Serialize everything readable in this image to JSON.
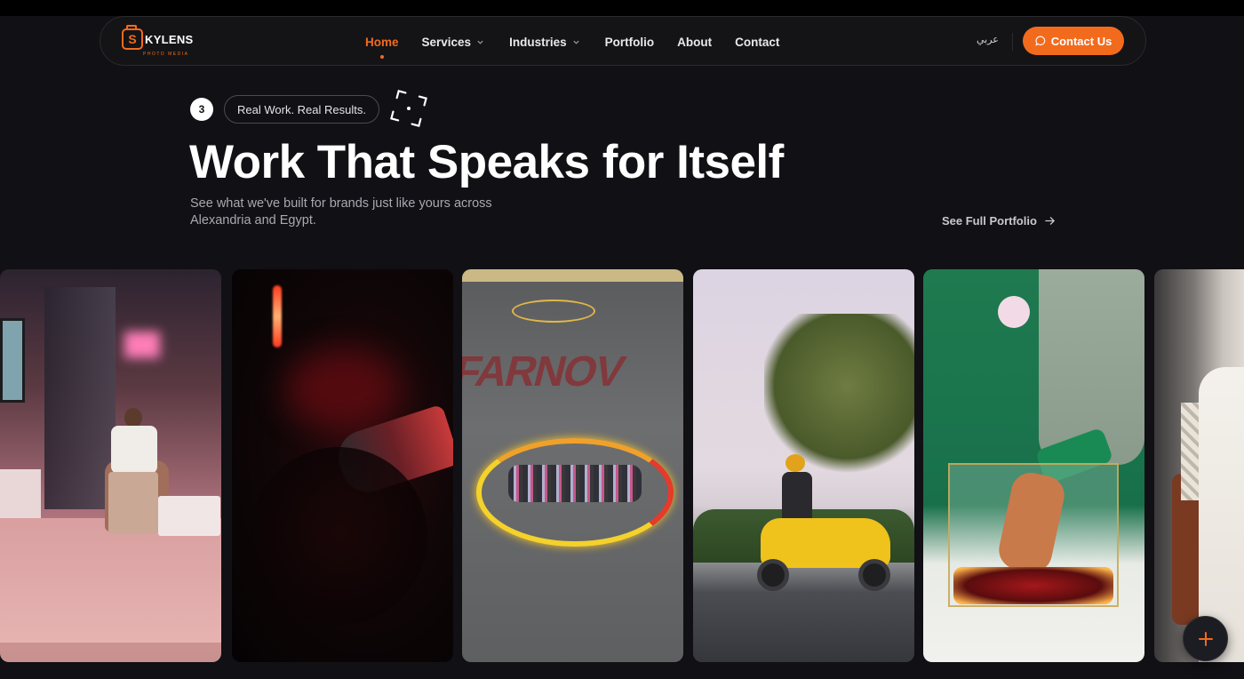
{
  "brand": {
    "name": "KYLENS",
    "logo_letter": "S",
    "logo_tagline": "PHOTO MEDIA",
    "accent": "#f26b1d"
  },
  "nav": {
    "items": [
      {
        "label": "Home",
        "active": true,
        "has_dropdown": false
      },
      {
        "label": "Services",
        "active": false,
        "has_dropdown": true
      },
      {
        "label": "Industries",
        "active": false,
        "has_dropdown": true
      },
      {
        "label": "Portfolio",
        "active": false,
        "has_dropdown": false
      },
      {
        "label": "About",
        "active": false,
        "has_dropdown": false
      },
      {
        "label": "Contact",
        "active": false,
        "has_dropdown": false
      }
    ],
    "language_toggle": "عربي",
    "contact_button": "Contact Us"
  },
  "hero": {
    "step_number": "3",
    "tagline": "Real Work. Real Results.",
    "title": "Work That Speaks for Itself",
    "description": "See what we've built for brands just like yours across Alexandria and Egypt.",
    "see_full_link": "See Full Portfolio"
  },
  "portfolio": {
    "cards": [
      {
        "subject": "living-room-shoot"
      },
      {
        "subject": "red-motorcycle-closeup"
      },
      {
        "subject": "aerial-scooters-circle"
      },
      {
        "subject": "scooter-rider"
      },
      {
        "subject": "glass-box-product"
      },
      {
        "subject": "seated-woman"
      }
    ],
    "aerial_text": "FARNOV"
  },
  "icons": {
    "focus": "focus-frame-icon",
    "chat": "chat-bubble-icon",
    "arrow": "arrow-right-icon",
    "plus": "plus-icon",
    "chevron": "chevron-down-icon"
  }
}
